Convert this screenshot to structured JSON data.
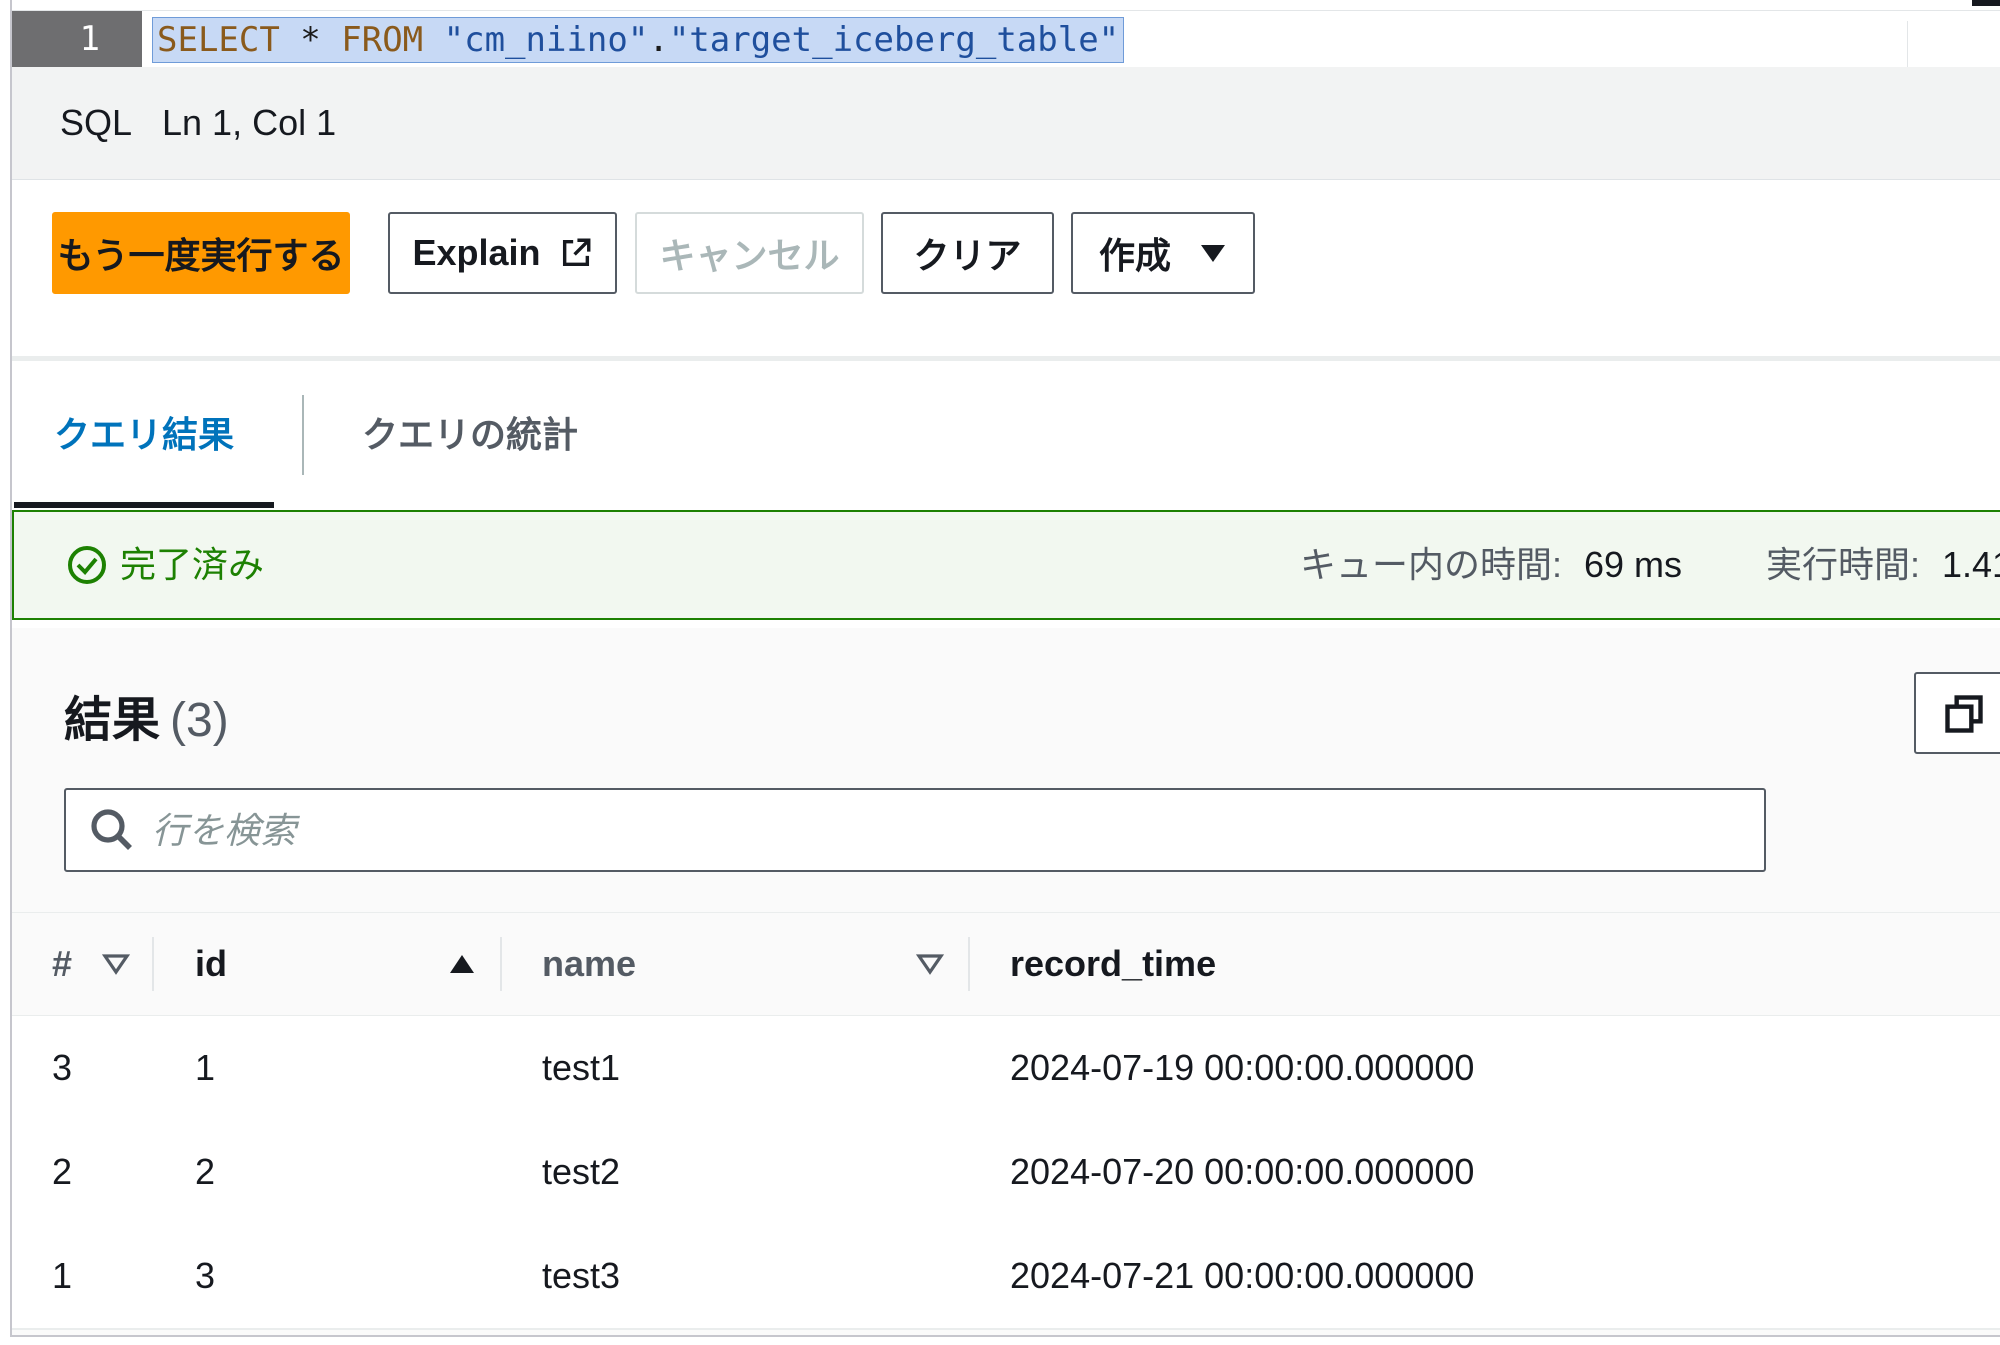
{
  "editor": {
    "line_number": "1",
    "code_tokens": {
      "select": "SELECT",
      "star": " * ",
      "from": "FROM",
      "space": " ",
      "schema": "\"cm_niino\"",
      "dot": ".",
      "table": "\"target_iceberg_table\""
    }
  },
  "status_bar": {
    "language": "SQL",
    "cursor": "Ln 1, Col 1"
  },
  "toolbar": {
    "rerun_label": "もう一度実行する",
    "explain_label": "Explain",
    "cancel_label": "キャンセル",
    "clear_label": "クリア",
    "create_label": "作成"
  },
  "tabs": {
    "results_label": "クエリ結果",
    "stats_label": "クエリの統計"
  },
  "status": {
    "state": "完了済み",
    "queue_label": "キュー内の時間:",
    "queue_value": "69 ms",
    "exec_label": "実行時間:",
    "exec_value": "1.41"
  },
  "results": {
    "title": "結果",
    "count": "(3)",
    "search_placeholder": "行を検索",
    "columns": [
      "#",
      "id",
      "name",
      "record_time"
    ],
    "sorted_column": "id",
    "rows": [
      {
        "num": "3",
        "id": "1",
        "name": "test1",
        "record_time": "2024-07-19 00:00:00.000000"
      },
      {
        "num": "2",
        "id": "2",
        "name": "test2",
        "record_time": "2024-07-20 00:00:00.000000"
      },
      {
        "num": "1",
        "id": "3",
        "name": "test3",
        "record_time": "2024-07-21 00:00:00.000000"
      }
    ]
  },
  "colors": {
    "primary": "#ff9900",
    "link": "#0073bb",
    "success": "#1d8102",
    "selection": "#c7d9f5"
  },
  "icons": [
    "external-link-icon",
    "caret-down-icon",
    "check-circle-icon",
    "copy-icon",
    "search-icon",
    "sort-down-icon",
    "sort-up-icon"
  ]
}
